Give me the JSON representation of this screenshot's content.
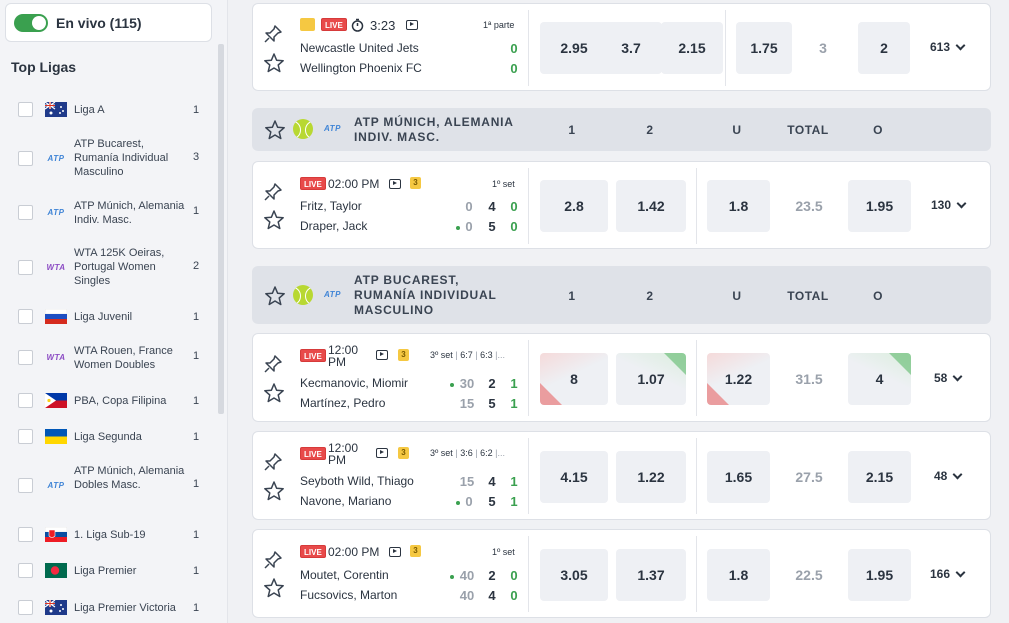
{
  "sidebar": {
    "live_label": "En vivo (115)",
    "top_title": "Top Ligas",
    "leagues": [
      {
        "name": "Liga A",
        "count": "1",
        "icon": "flag-au"
      },
      {
        "name": "ATP Bucarest, Rumanía Individual Masculino",
        "count": "3",
        "icon": "atp"
      },
      {
        "name": "ATP Múnich, Alemania Indiv. Masc.",
        "count": "1",
        "icon": "atp"
      },
      {
        "name": "WTA 125K Oeiras, Portugal Women Singles",
        "count": "2",
        "icon": "wta"
      },
      {
        "name": "Liga Juvenil",
        "count": "1",
        "icon": "flag-ru"
      },
      {
        "name": "WTA Rouen, France Women Doubles",
        "count": "1",
        "icon": "wta"
      },
      {
        "name": "PBA, Copa Filipina",
        "count": "1",
        "icon": "flag-ph"
      },
      {
        "name": "Liga Segunda",
        "count": "1",
        "icon": "flag-ua"
      },
      {
        "name": "ATP Múnich, Alemania Dobles Masc.",
        "count": "1",
        "icon": "atp"
      },
      {
        "name": "1. Liga Sub-19",
        "count": "1",
        "icon": "flag-sk"
      },
      {
        "name": "Liga Premier",
        "count": "1",
        "icon": "flag-bd"
      },
      {
        "name": "Liga Premier Victoria",
        "count": "1",
        "icon": "flag-au"
      }
    ]
  },
  "icons": {
    "atp": "ATP",
    "wta": "WTA"
  },
  "football_match": {
    "live": "LIVE",
    "clock": "3:23",
    "period": "1ª parte",
    "home": "Newcastle United Jets",
    "away": "Wellington Phoenix FC",
    "home_score": "0",
    "away_score": "0",
    "odds": [
      "2.95",
      "3.7",
      "2.15",
      "1.75"
    ],
    "line": "3",
    "odd_last": "2",
    "more": "613"
  },
  "group_munich": {
    "title_line1": "ATP MÚNICH, ALEMANIA",
    "title_line2": "INDIV. MASC.",
    "cols": [
      "1",
      "2",
      "U",
      "TOTAL",
      "O"
    ]
  },
  "group_bucarest": {
    "title_line1": "ATP BUCAREST,",
    "title_line2": "RUMANÍA INDIVIDUAL",
    "title_line3": "MASCULINO",
    "cols": [
      "1",
      "2",
      "U",
      "TOTAL",
      "O"
    ]
  },
  "matches": [
    {
      "live": "LIVE",
      "time": "02:00 PM",
      "badge": "3",
      "period": "1º set",
      "p1": "Fritz, Taylor",
      "p2": "Draper, Jack",
      "p1_game": "0",
      "p1_set": "4",
      "p1_sets": "0",
      "p2_game": "0",
      "p2_set": "5",
      "p2_sets": "0",
      "odds": [
        "2.8",
        "1.42",
        "1.8",
        "23.5",
        "1.95"
      ],
      "more": "130"
    },
    {
      "live": "LIVE",
      "time_l1": "12:00",
      "time_l2": "PM",
      "badge": "3",
      "period": "3º set",
      "s1": "6:7",
      "s2": "6:3",
      "s3": "|...",
      "p1": "Kecmanovic, Miomir",
      "p2": "Martínez, Pedro",
      "p1_game": "30",
      "p1_set": "2",
      "p1_sets": "1",
      "p2_game": "15",
      "p2_set": "5",
      "p2_sets": "1",
      "odds": [
        "8",
        "1.07",
        "1.22",
        "31.5",
        "4"
      ],
      "more": "58"
    },
    {
      "live": "LIVE",
      "time_l1": "12:00",
      "time_l2": "PM",
      "badge": "3",
      "period": "3º set",
      "s1": "3:6",
      "s2": "6:2",
      "s3": "|...",
      "p1": "Seyboth Wild, Thiago",
      "p2": "Navone, Mariano",
      "p1_game": "15",
      "p1_set": "4",
      "p1_sets": "1",
      "p2_game": "0",
      "p2_set": "5",
      "p2_sets": "1",
      "odds": [
        "4.15",
        "1.22",
        "1.65",
        "27.5",
        "2.15"
      ],
      "more": "48"
    },
    {
      "live": "LIVE",
      "time": "02:00 PM",
      "badge": "3",
      "period": "1º set",
      "p1": "Moutet, Corentin",
      "p2": "Fucsovics, Marton",
      "p1_game": "40",
      "p1_set": "2",
      "p1_sets": "0",
      "p2_game": "40",
      "p2_set": "4",
      "p2_sets": "0",
      "odds": [
        "3.05",
        "1.37",
        "1.8",
        "22.5",
        "1.95"
      ],
      "more": "166"
    }
  ],
  "colors": {
    "accent_green": "#3aa04f",
    "live_red": "#e84a4a",
    "odds_bg": "#eef0f4"
  }
}
